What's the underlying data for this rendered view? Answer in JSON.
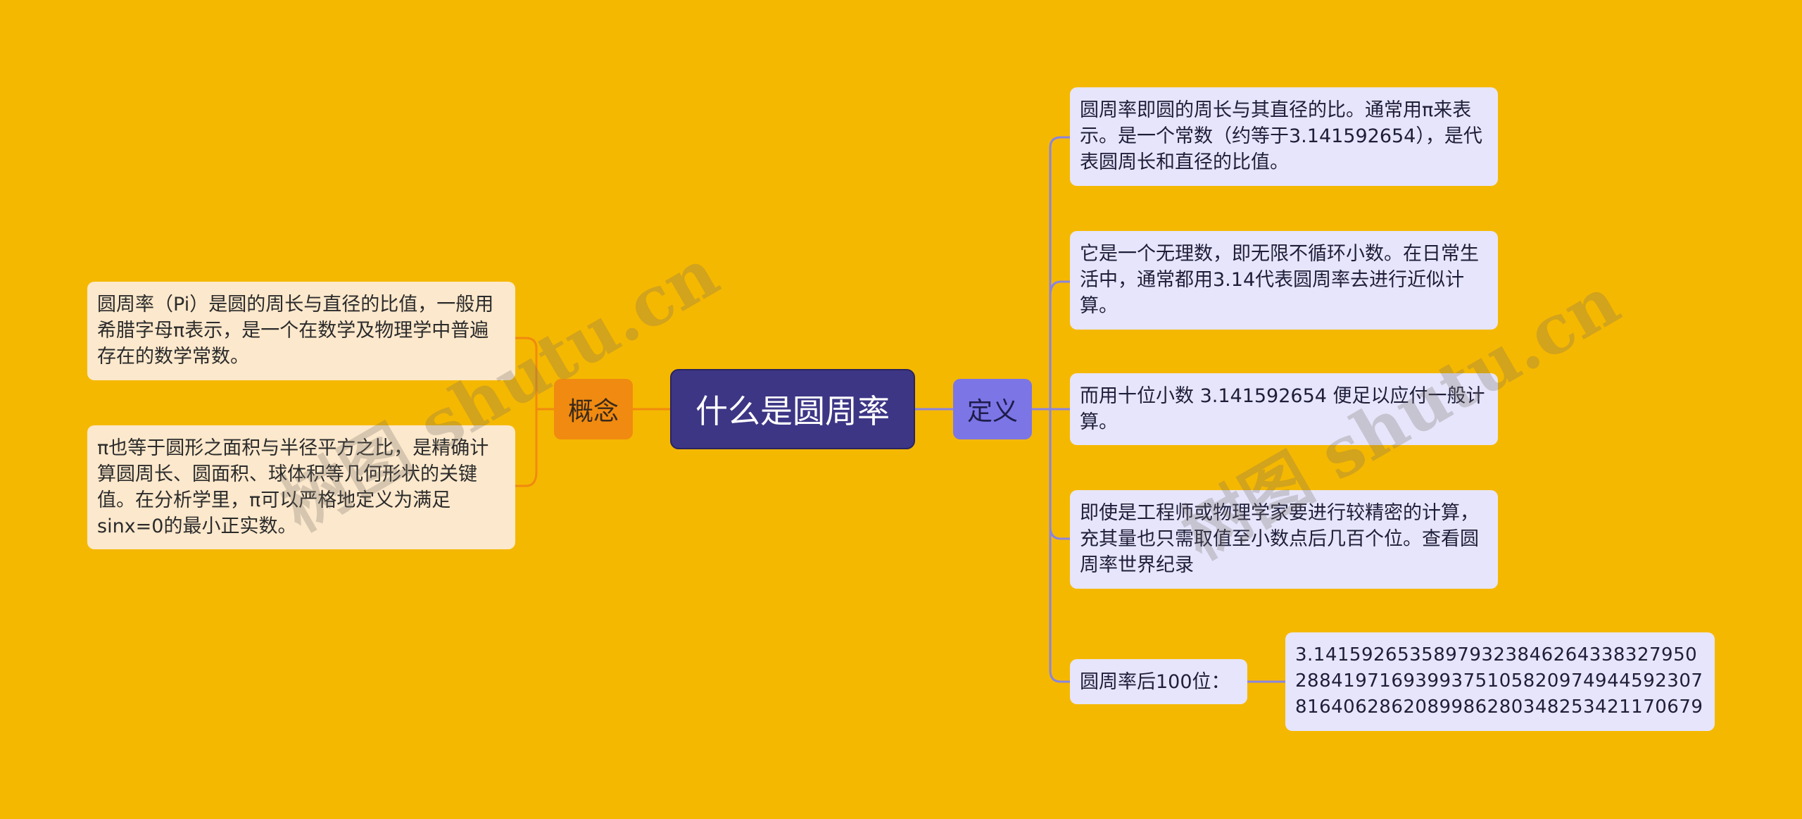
{
  "root": {
    "label": "什么是圆周率"
  },
  "branches": {
    "left": {
      "label": "概念",
      "items": [
        "圆周率（Pi）是圆的周长与直径的比值，一般用希腊字母π表示，是一个在数学及物理学中普遍存在的数学常数。",
        "π也等于圆形之面积与半径平方之比，是精确计算圆周长、圆面积、球体积等几何形状的关键值。在分析学里，π可以严格地定义为满足sinx=0的最小正实数。"
      ]
    },
    "right": {
      "label": "定义",
      "items": [
        "圆周率即圆的周长与其直径的比。通常用π来表示。是一个常数（约等于3.141592654），是代表圆周长和直径的比值。",
        "它是一个无理数，即无限不循环小数。在日常生活中，通常都用3.14代表圆周率去进行近似计算。",
        "而用十位小数 3.141592654 便足以应付一般计算。",
        "即使是工程师或物理学家要进行较精密的计算，充其量也只需取值至小数点后几百个位。查看圆周率世界纪录",
        "圆周率后100位："
      ],
      "sub": "3.1415926535897932384626433832795028841971693993751058209749445923078164062862089986280348253421170679"
    }
  },
  "watermark": {
    "text": "树图 shutu.cn"
  },
  "colors": {
    "background": "#f5b800",
    "root": "#3d3685",
    "left_branch": "#f08a10",
    "right_branch": "#7b75e6",
    "left_leaf": "#fce8cc",
    "right_leaf": "#e6e5fb",
    "left_link": "#f08a10",
    "right_link": "#8a84e0"
  }
}
